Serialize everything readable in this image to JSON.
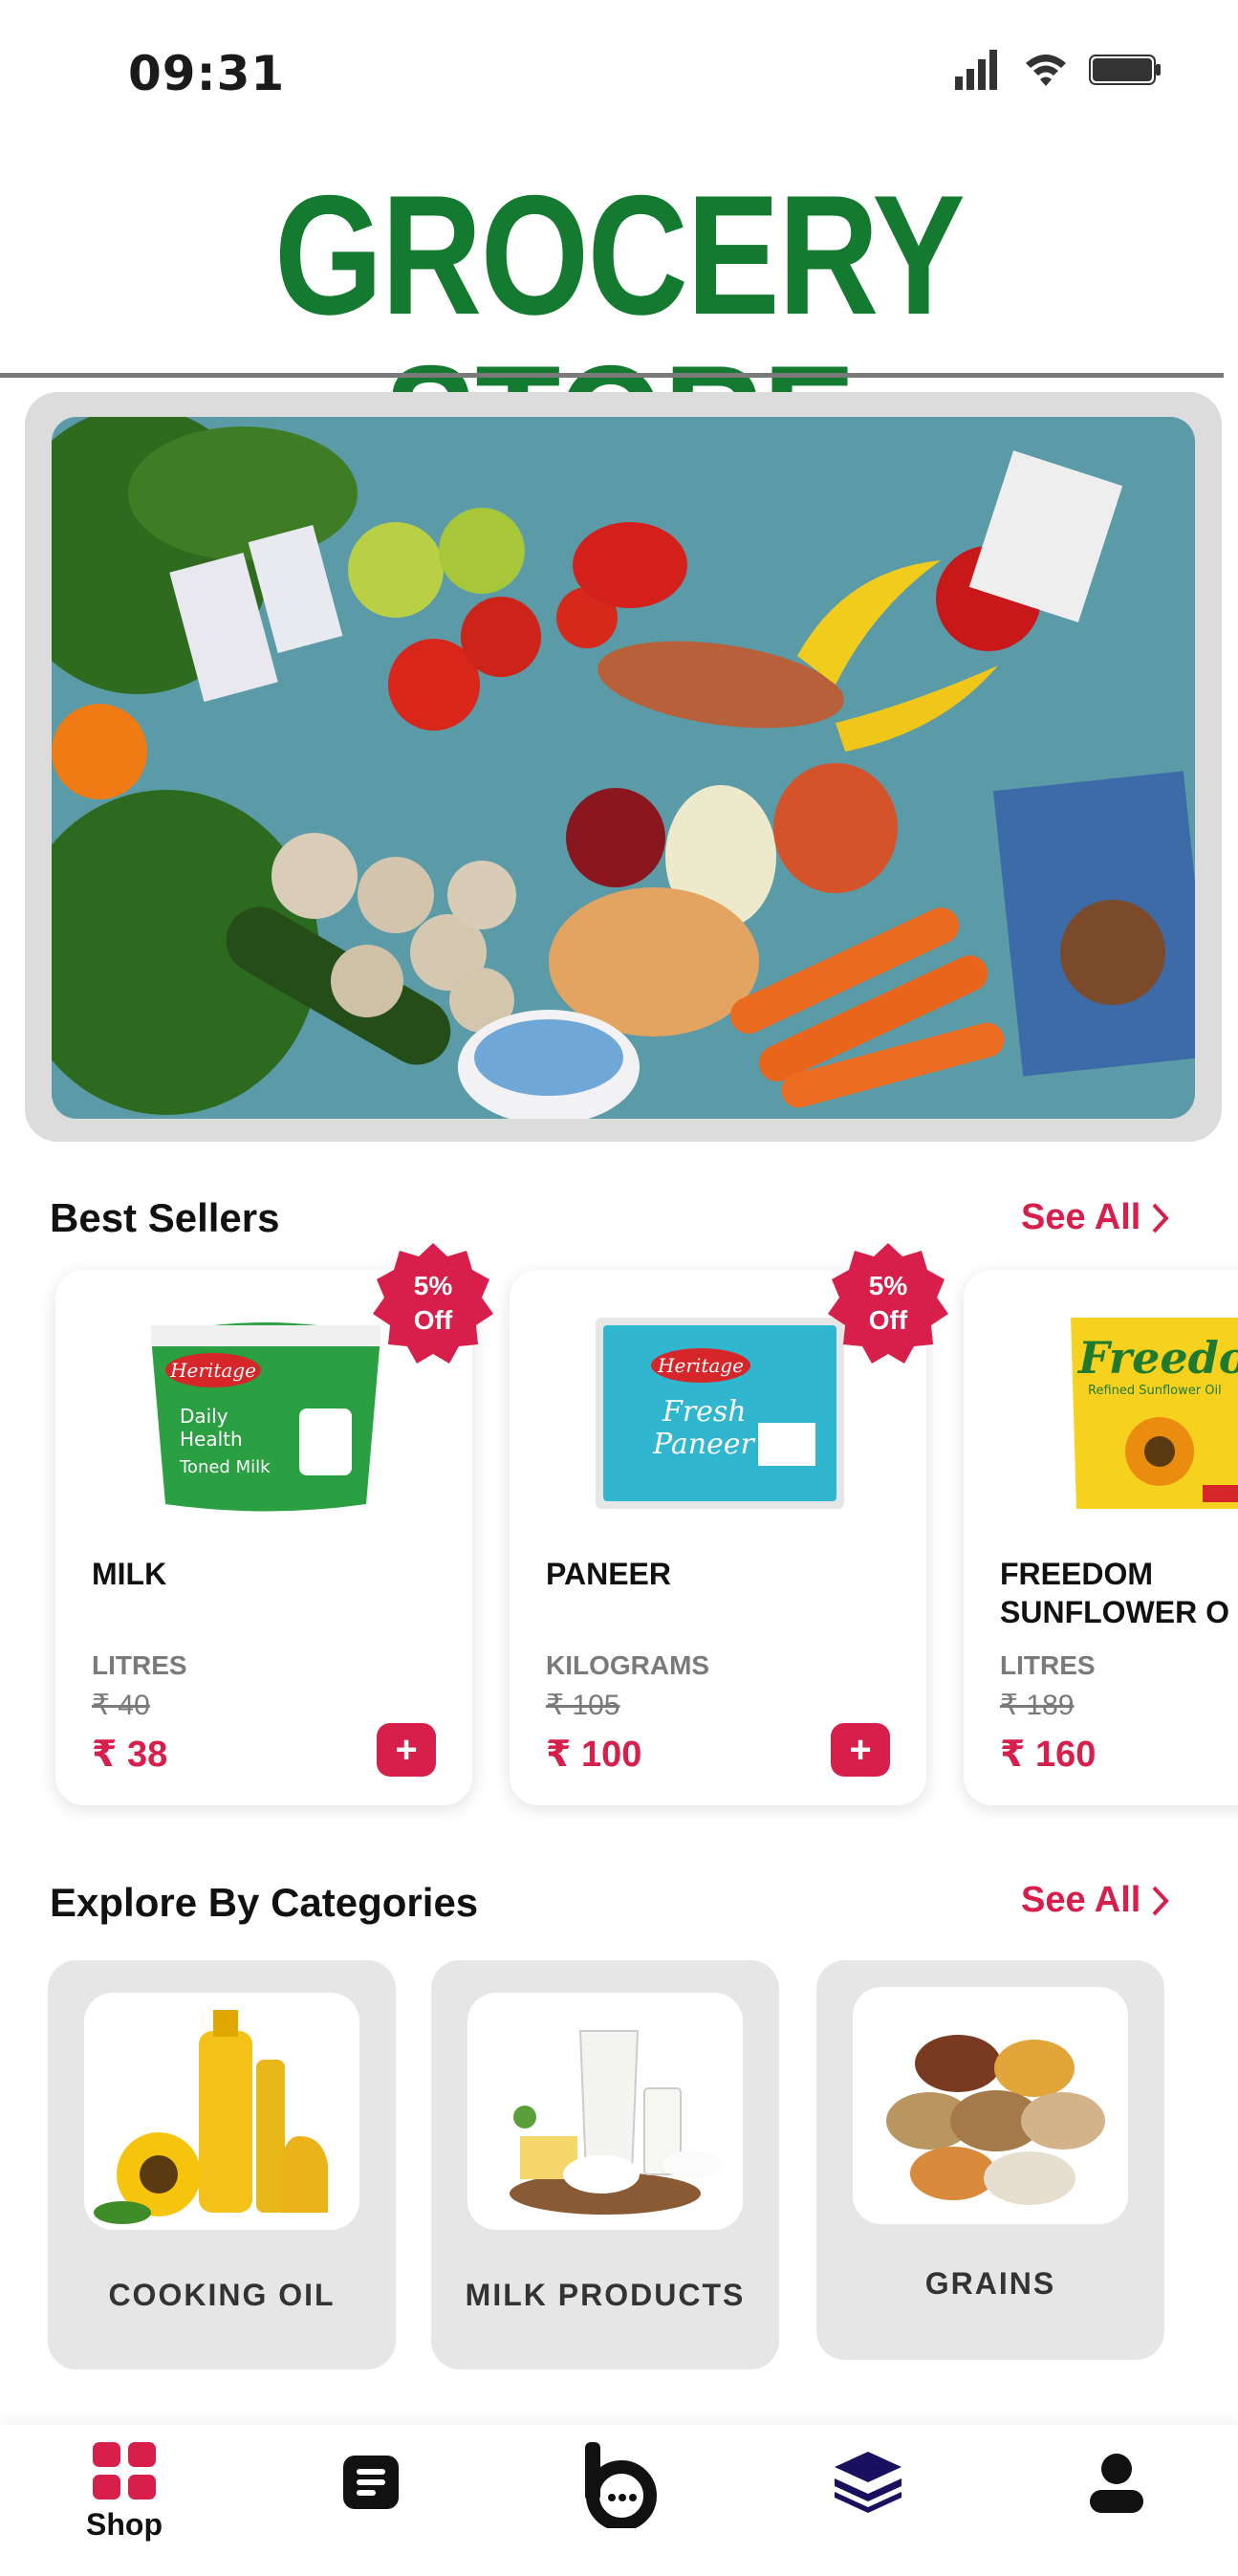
{
  "status_bar": {
    "time": "09:31"
  },
  "header": {
    "title": "GROCERY STORE"
  },
  "best_sellers": {
    "title": "Best Sellers",
    "see_all": "See All",
    "products": [
      {
        "name": "MILK",
        "unit": "LITRES",
        "old_price": "₹ 40",
        "price": "₹ 38",
        "discount_line1": "5%",
        "discount_line2": "Off",
        "brand": "Heritage",
        "image_text": "Daily Health Toned Milk"
      },
      {
        "name": "PANEER",
        "unit": "KILOGRAMS",
        "old_price": "₹ 105",
        "price": "₹ 100",
        "discount_line1": "5%",
        "discount_line2": "Off",
        "brand": "Heritage",
        "image_text": "Fresh Paneer"
      },
      {
        "name": "FREEDOM\nSUNFLOWER O",
        "unit": "LITRES",
        "old_price": "₹ 189",
        "price": "₹ 160",
        "brand": "Freedom",
        "image_text": "Refined Sunflower Oil"
      }
    ],
    "add_symbol": "+"
  },
  "categories": {
    "title": "Explore By Categories",
    "see_all": "See All",
    "items": [
      {
        "label": "COOKING OIL"
      },
      {
        "label": "MILK PRODUCTS"
      },
      {
        "label": "GRAINS"
      }
    ]
  },
  "bottom_nav": {
    "items": [
      {
        "label": "Shop",
        "icon": "grid-icon",
        "active": true
      },
      {
        "label": "",
        "icon": "document-icon"
      },
      {
        "label": "",
        "icon": "chat-icon"
      },
      {
        "label": "",
        "icon": "layers-icon"
      },
      {
        "label": "",
        "icon": "user-icon"
      }
    ]
  },
  "colors": {
    "brand_green": "#137a30",
    "accent_red": "#d81e4a",
    "card_grey": "#e6e6e6"
  }
}
